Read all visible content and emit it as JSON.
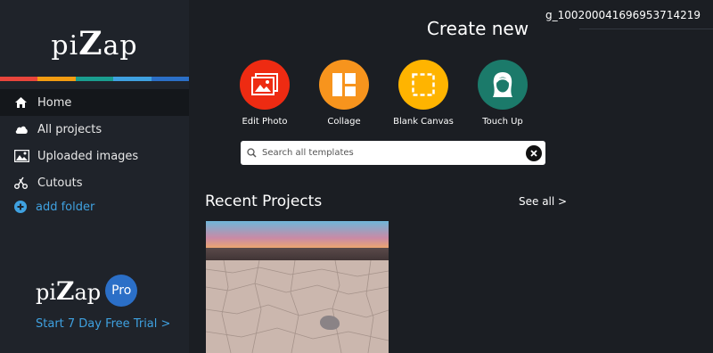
{
  "brand": {
    "logo_text_pre": "pi",
    "logo_text_z": "Z",
    "logo_text_post": "ap"
  },
  "accent_colors": [
    "#e8453c",
    "#f39c12",
    "#1a9e8f",
    "#3fa1e0",
    "#2b6fc7"
  ],
  "sidebar": {
    "items": [
      {
        "label": "Home",
        "icon": "home-icon"
      },
      {
        "label": "All projects",
        "icon": "cloud-icon"
      },
      {
        "label": "Uploaded images",
        "icon": "image-icon"
      },
      {
        "label": "Cutouts",
        "icon": "scissors-icon"
      }
    ],
    "add_folder": "add folder",
    "pro": {
      "logo_pre": "pi",
      "logo_z": "Z",
      "logo_post": "ap",
      "badge": "Pro"
    },
    "trial_link": "Start 7 Day Free Trial >"
  },
  "header": {
    "user_id": "g_100200041696953714219"
  },
  "main": {
    "create_title": "Create new",
    "tools": [
      {
        "label": "Edit Photo",
        "color": "#ee2b12",
        "icon": "photo-icon"
      },
      {
        "label": "Collage",
        "color": "#f7941d",
        "icon": "collage-icon"
      },
      {
        "label": "Blank Canvas",
        "color": "#ffb400",
        "icon": "blank-canvas-icon"
      },
      {
        "label": "Touch Up",
        "color": "#1b7a6a",
        "icon": "face-icon"
      }
    ],
    "search": {
      "placeholder": "Search all templates",
      "value": ""
    },
    "recent_title": "Recent Projects",
    "see_all": "See all >"
  }
}
